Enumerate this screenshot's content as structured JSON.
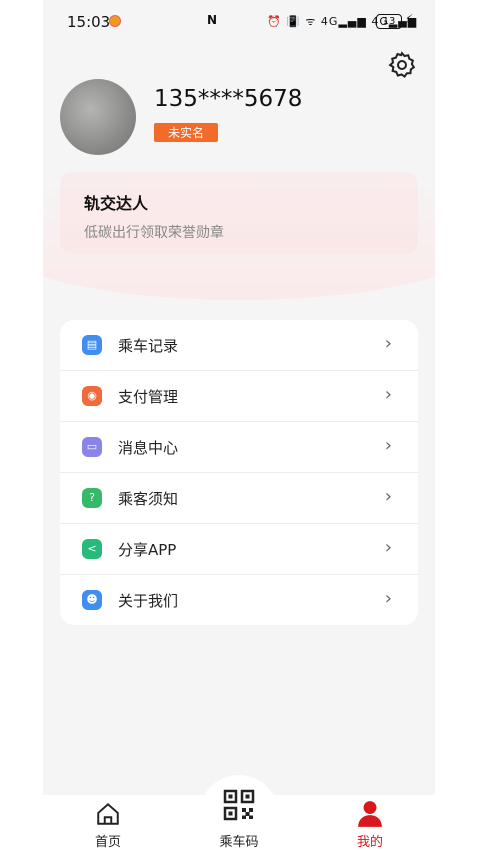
{
  "status_bar": {
    "time": "15:03",
    "nfc": "N",
    "signal_text": "⏰ 📳 ᯤ 4G▂▄▆ 4G▂▄▆",
    "battery": "13",
    "charging": "⚡"
  },
  "profile": {
    "phone_masked": "135****5678",
    "verify_badge": "未实名"
  },
  "achievement": {
    "title": "轨交达人",
    "subtitle": "低碳出行领取荣誉勋章"
  },
  "menu": {
    "items": [
      {
        "label": "乘车记录",
        "icon": "ride-record-icon",
        "color": "#3f8ef0"
      },
      {
        "label": "支付管理",
        "icon": "payment-icon",
        "color": "#f06a3a"
      },
      {
        "label": "消息中心",
        "icon": "message-icon",
        "color": "#8a84e8"
      },
      {
        "label": "乘客须知",
        "icon": "notice-icon",
        "color": "#37b96a"
      },
      {
        "label": "分享APP",
        "icon": "share-icon",
        "color": "#26bb7a"
      },
      {
        "label": "关于我们",
        "icon": "about-icon",
        "color": "#3f8ef0"
      }
    ],
    "arrow": "›"
  },
  "tabbar": {
    "home": "首页",
    "ride_code": "乘车码",
    "mine": "我的",
    "active_color": "#d9181e"
  }
}
